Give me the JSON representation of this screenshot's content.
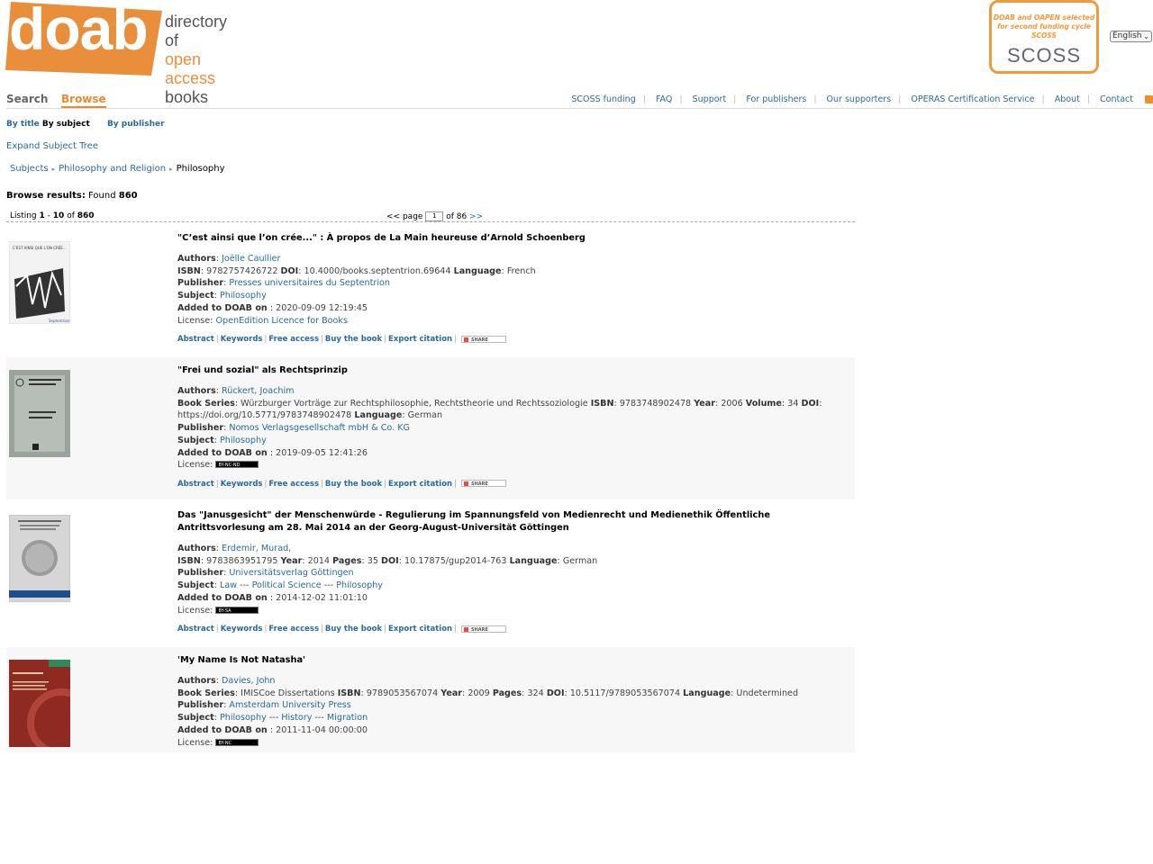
{
  "header": {
    "logo_word": "doab",
    "logo_tag": [
      "directory of",
      "open access",
      "books"
    ],
    "scoss_banner_text": "DOAB and OAPEN selected for second funding cycle SCOSS",
    "scoss_logo": "SCOSS",
    "language": "English"
  },
  "nav": {
    "search": "Search",
    "browse": "Browse",
    "links": [
      "SCOSS funding",
      "FAQ",
      "Support",
      "For publishers",
      "Our supporters",
      "OPERAS Certification Service",
      "About",
      "Contact"
    ]
  },
  "subnav": {
    "by_title": "By title",
    "by_subject": "By subject",
    "by_publisher": "By publisher"
  },
  "expand_tree": "Expand Subject Tree",
  "breadcrumb": {
    "subjects": "Subjects",
    "parent": "Philosophy and Religion",
    "current": "Philosophy"
  },
  "results": {
    "label": "Browse results:",
    "found_label": "Found",
    "count": "860"
  },
  "listing": {
    "listing_label": "Listing",
    "from": "1",
    "dash": "-",
    "to": "10",
    "of_label": "of",
    "total": "860",
    "prev": "<<",
    "page_label": "page",
    "page": "1",
    "of_pages": "of 86",
    "next": ">>"
  },
  "actions": {
    "abstract": "Abstract",
    "keywords": "Keywords",
    "free_access": "Free access",
    "buy": "Buy the book",
    "export": "Export citation",
    "share": "SHARE"
  },
  "labels": {
    "authors": "Authors",
    "isbn": "ISBN",
    "doi": "DOI",
    "language": "Language",
    "publisher": "Publisher",
    "subject": "Subject",
    "added": "Added to DOAB on",
    "license": "License",
    "book_series": "Book Series",
    "year": "Year",
    "volume": "Volume",
    "pages": "Pages"
  },
  "records": [
    {
      "title": "\"C’est ainsi que l’on crée...\" : À propos de La Main heureuse d’Arnold Schoenberg",
      "authors": "Joëlle Caullier",
      "isbn": "9782757426722",
      "doi": "10.4000/books.septentrion.69644",
      "language": "French",
      "publisher": "Presses universitaires du Septentrion",
      "subject": "Philosophy",
      "added": "2020-09-09 12:19:45",
      "license": "OpenEdition Licence for Books",
      "cover_color": "#f3f3f3"
    },
    {
      "title": "\"Frei und sozial\" als Rechtsprinzip",
      "authors": "Rückert, Joachim",
      "book_series": "Würzburger Vorträge zur Rechtsphilosophie, Rechtstheorie und Rechtssoziologie",
      "isbn": "9783748902478",
      "year": "2006",
      "volume": "34",
      "doi": "https://doi.org/10.5771/9783748902478",
      "language": "German",
      "publisher": "Nomos Verlagsgesellschaft mbH & Co. KG",
      "subject": "Philosophy",
      "added": "2019-09-05 12:41:26",
      "license_badge": "BY-NC-ND",
      "cover_color": "#9aa39c"
    },
    {
      "title": "Das \"Janusgesicht\" der Menschenwürde - Regulierung im Spannungsfeld von Medienrecht und Medienethik Öffentliche Antrittsvorlesung am 28. Mai 2014 an der Georg-August-Universität Göttingen",
      "authors": "Erdemir, Murad,",
      "isbn": "9783863951795",
      "year": "2014",
      "pages": "35",
      "doi": "10.17875/gup2014-763",
      "language": "German",
      "publisher": "Universitätsverlag Göttingen",
      "subjects": [
        "Law",
        "Political Science",
        "Philosophy"
      ],
      "added": "2014-12-02 11:01:10",
      "license_badge": "BY-SA",
      "cover_color": "#d6d6d6"
    },
    {
      "title": "'My Name Is Not Natasha'",
      "authors": "Davies, John",
      "book_series": "IMISCoe Dissertations",
      "isbn": "9789053567074",
      "year": "2009",
      "pages": "324",
      "doi": "10.5117/9789053567074",
      "language": "Undetermined",
      "publisher": "Amsterdam University Press",
      "subjects": [
        "Philosophy",
        "History",
        "Migration"
      ],
      "added": "2011-11-04 00:00:00",
      "license_badge": "BY-NC",
      "cover_color": "#8e2a22"
    }
  ]
}
